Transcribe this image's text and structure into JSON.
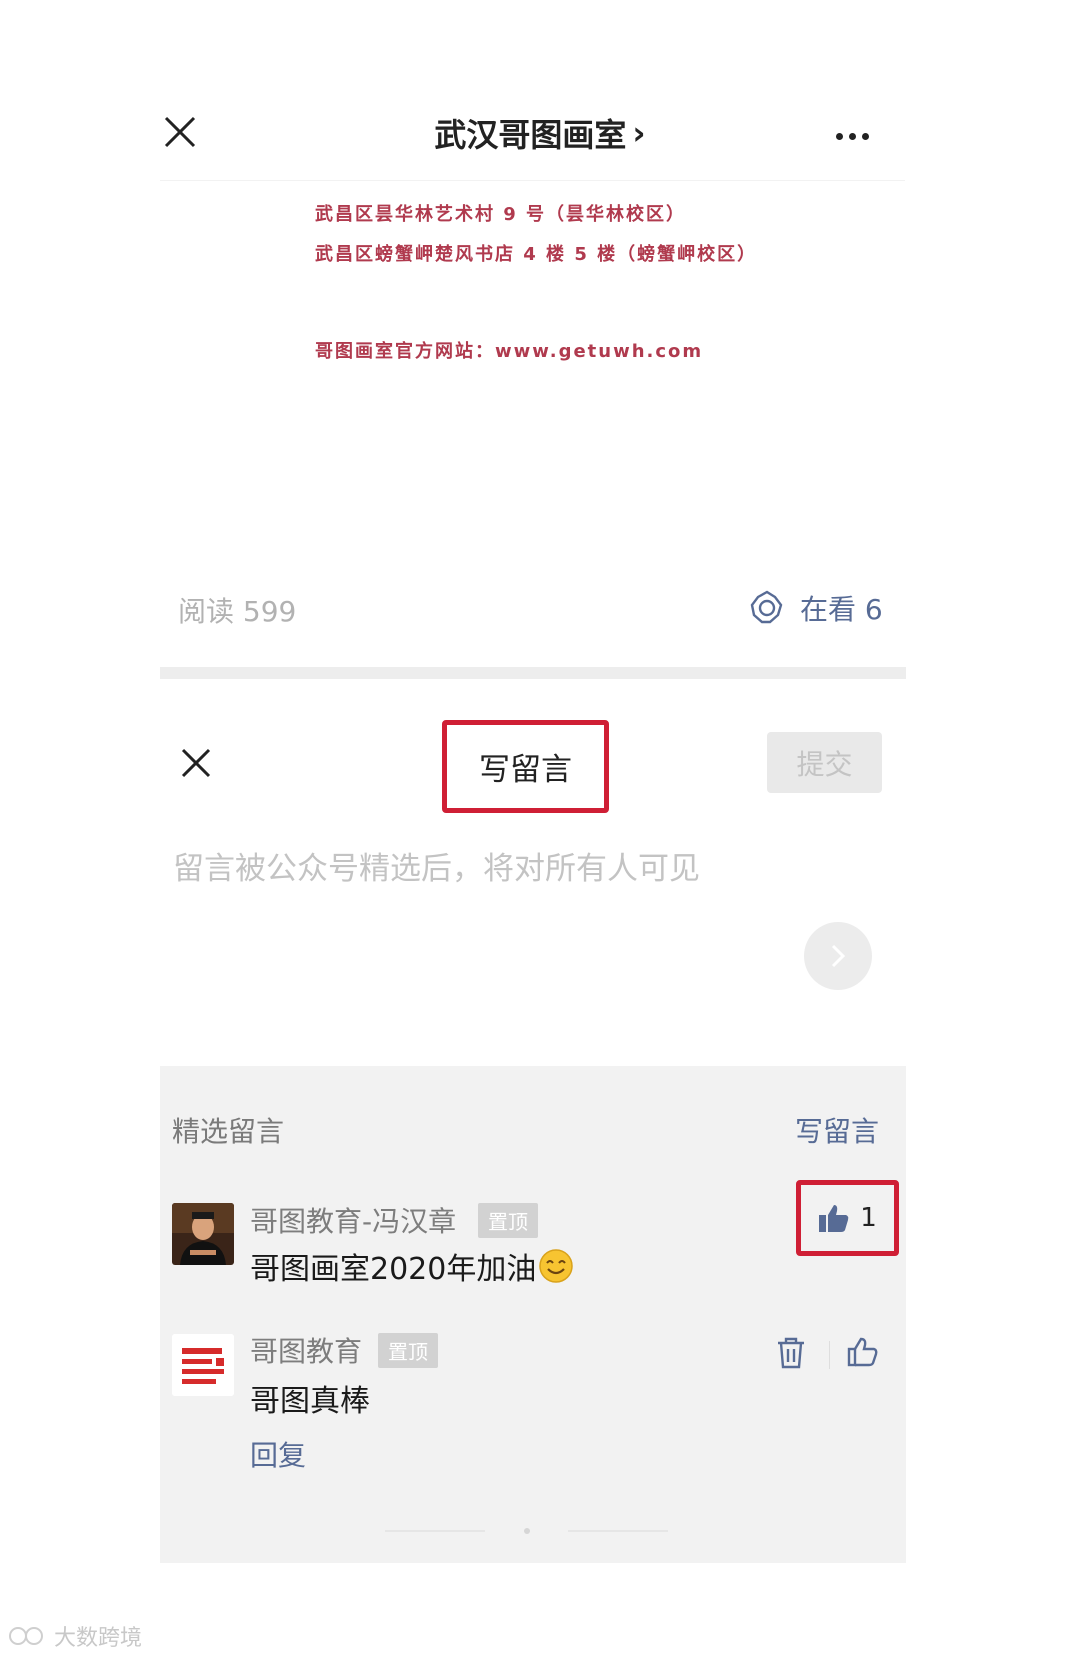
{
  "header": {
    "title": "武汉哥图画室",
    "chevron": "›",
    "close_icon": "close-icon",
    "more_icon": "more-icon"
  },
  "article": {
    "address_line_1": "武昌区昙华林艺术村 9 号（昙华林校区）",
    "address_line_2": "武昌区螃蟹岬楚风书店 4 楼 5 楼（螃蟹岬校区）",
    "website_line": "哥图画室官方网站：www.getuwh.com"
  },
  "stats": {
    "reads": "阅读 599",
    "seeing": "在看 6"
  },
  "compose": {
    "title": "写留言",
    "submit_label": "提交",
    "placeholder": "留言被公众号精选后，将对所有人可见"
  },
  "comments": {
    "section_label": "精选留言",
    "write_label": "写留言",
    "items": [
      {
        "nickname": "哥图教育-冯汉章",
        "badge": "置顶",
        "text": "哥图画室2020年加油",
        "likes": "1"
      },
      {
        "nickname": "哥图教育",
        "badge": "置顶",
        "text": "哥图真棒",
        "reply_label": "回复"
      }
    ]
  },
  "watermark": "大数跨境",
  "colors": {
    "accent_blue": "#576b95",
    "highlight_red": "#cf1f35",
    "article_text": "#b03a4e"
  }
}
